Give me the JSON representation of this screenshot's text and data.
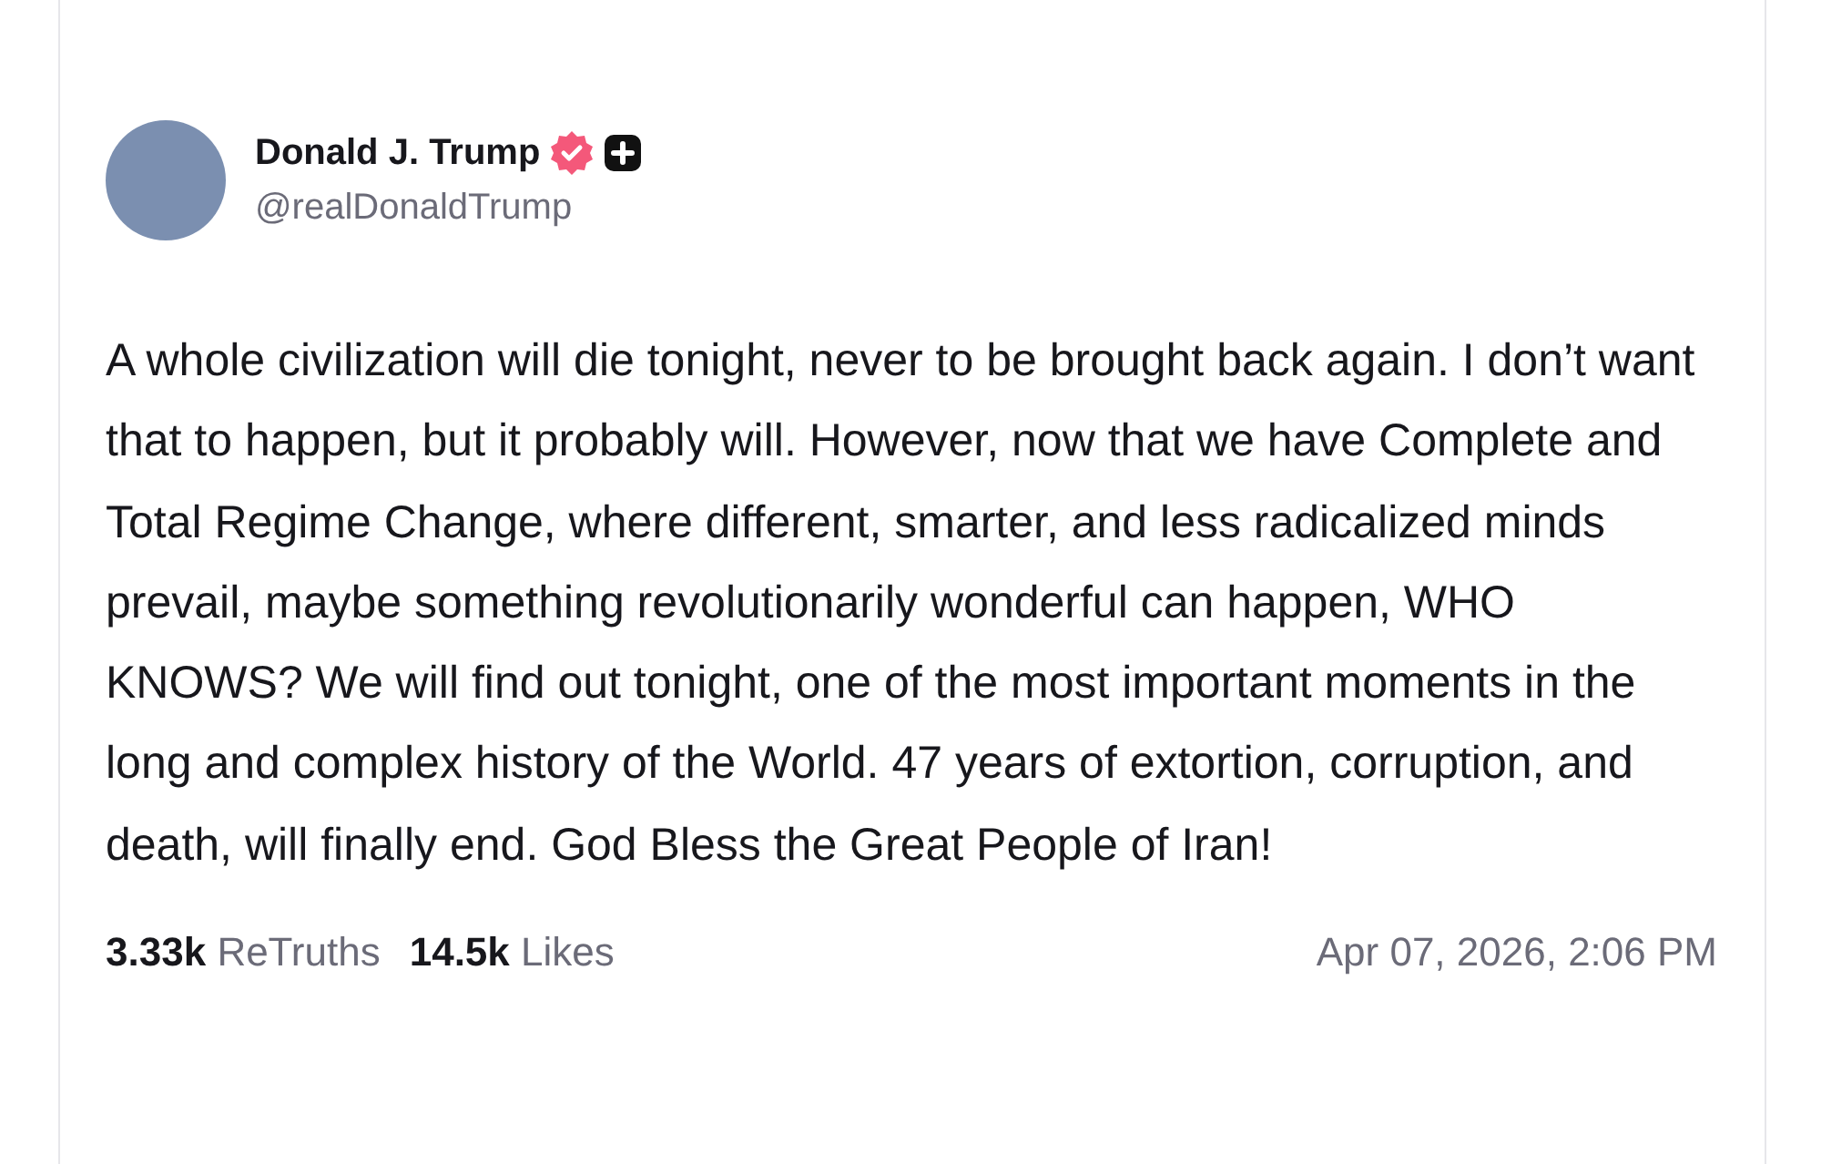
{
  "post": {
    "author": {
      "name": "Donald J. Trump",
      "verified": true,
      "handle": "@realDonaldTrump"
    },
    "text": "A whole civilization will die tonight, never to be brought back again. I don’t want that to happen, but it probably will. However, now that we have Complete and Total Regime Change, where different, smarter, and less radicalized minds prevail, maybe something revolutionarily wonderful can happen, WHO KNOWS? We will find out tonight, one of the most important moments in the long and complex history of the World. 47 years of extortion, corruption, and death, will finally end. God Bless the Great People of Iran!",
    "stats": [
      {
        "count": "3.33k",
        "label": "ReTruths"
      },
      {
        "count": "14.5k",
        "label": "Likes"
      }
    ],
    "timestamp": "Apr 07, 2026, 2:06 PM"
  }
}
